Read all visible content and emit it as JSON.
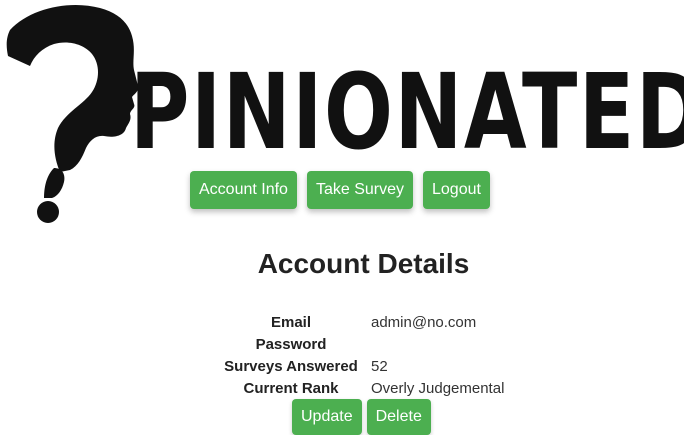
{
  "app": {
    "logo_text": "PINIONATED",
    "logo_icon": "question-mark-head-profile-icon"
  },
  "nav": {
    "account_info": "Account Info",
    "take_survey": "Take Survey",
    "logout": "Logout"
  },
  "main": {
    "title": "Account Details",
    "details": [
      {
        "label": "Email",
        "value": "admin@no.com"
      },
      {
        "label": "Password",
        "value": ""
      },
      {
        "label": "Surveys Answered",
        "value": "52"
      },
      {
        "label": "Current Rank",
        "value": "Overly Judgemental"
      }
    ],
    "update_label": "Update",
    "delete_label": "Delete"
  },
  "colors": {
    "button": "#4caf50",
    "button_text": "#ffffff",
    "logo": "#111111"
  }
}
